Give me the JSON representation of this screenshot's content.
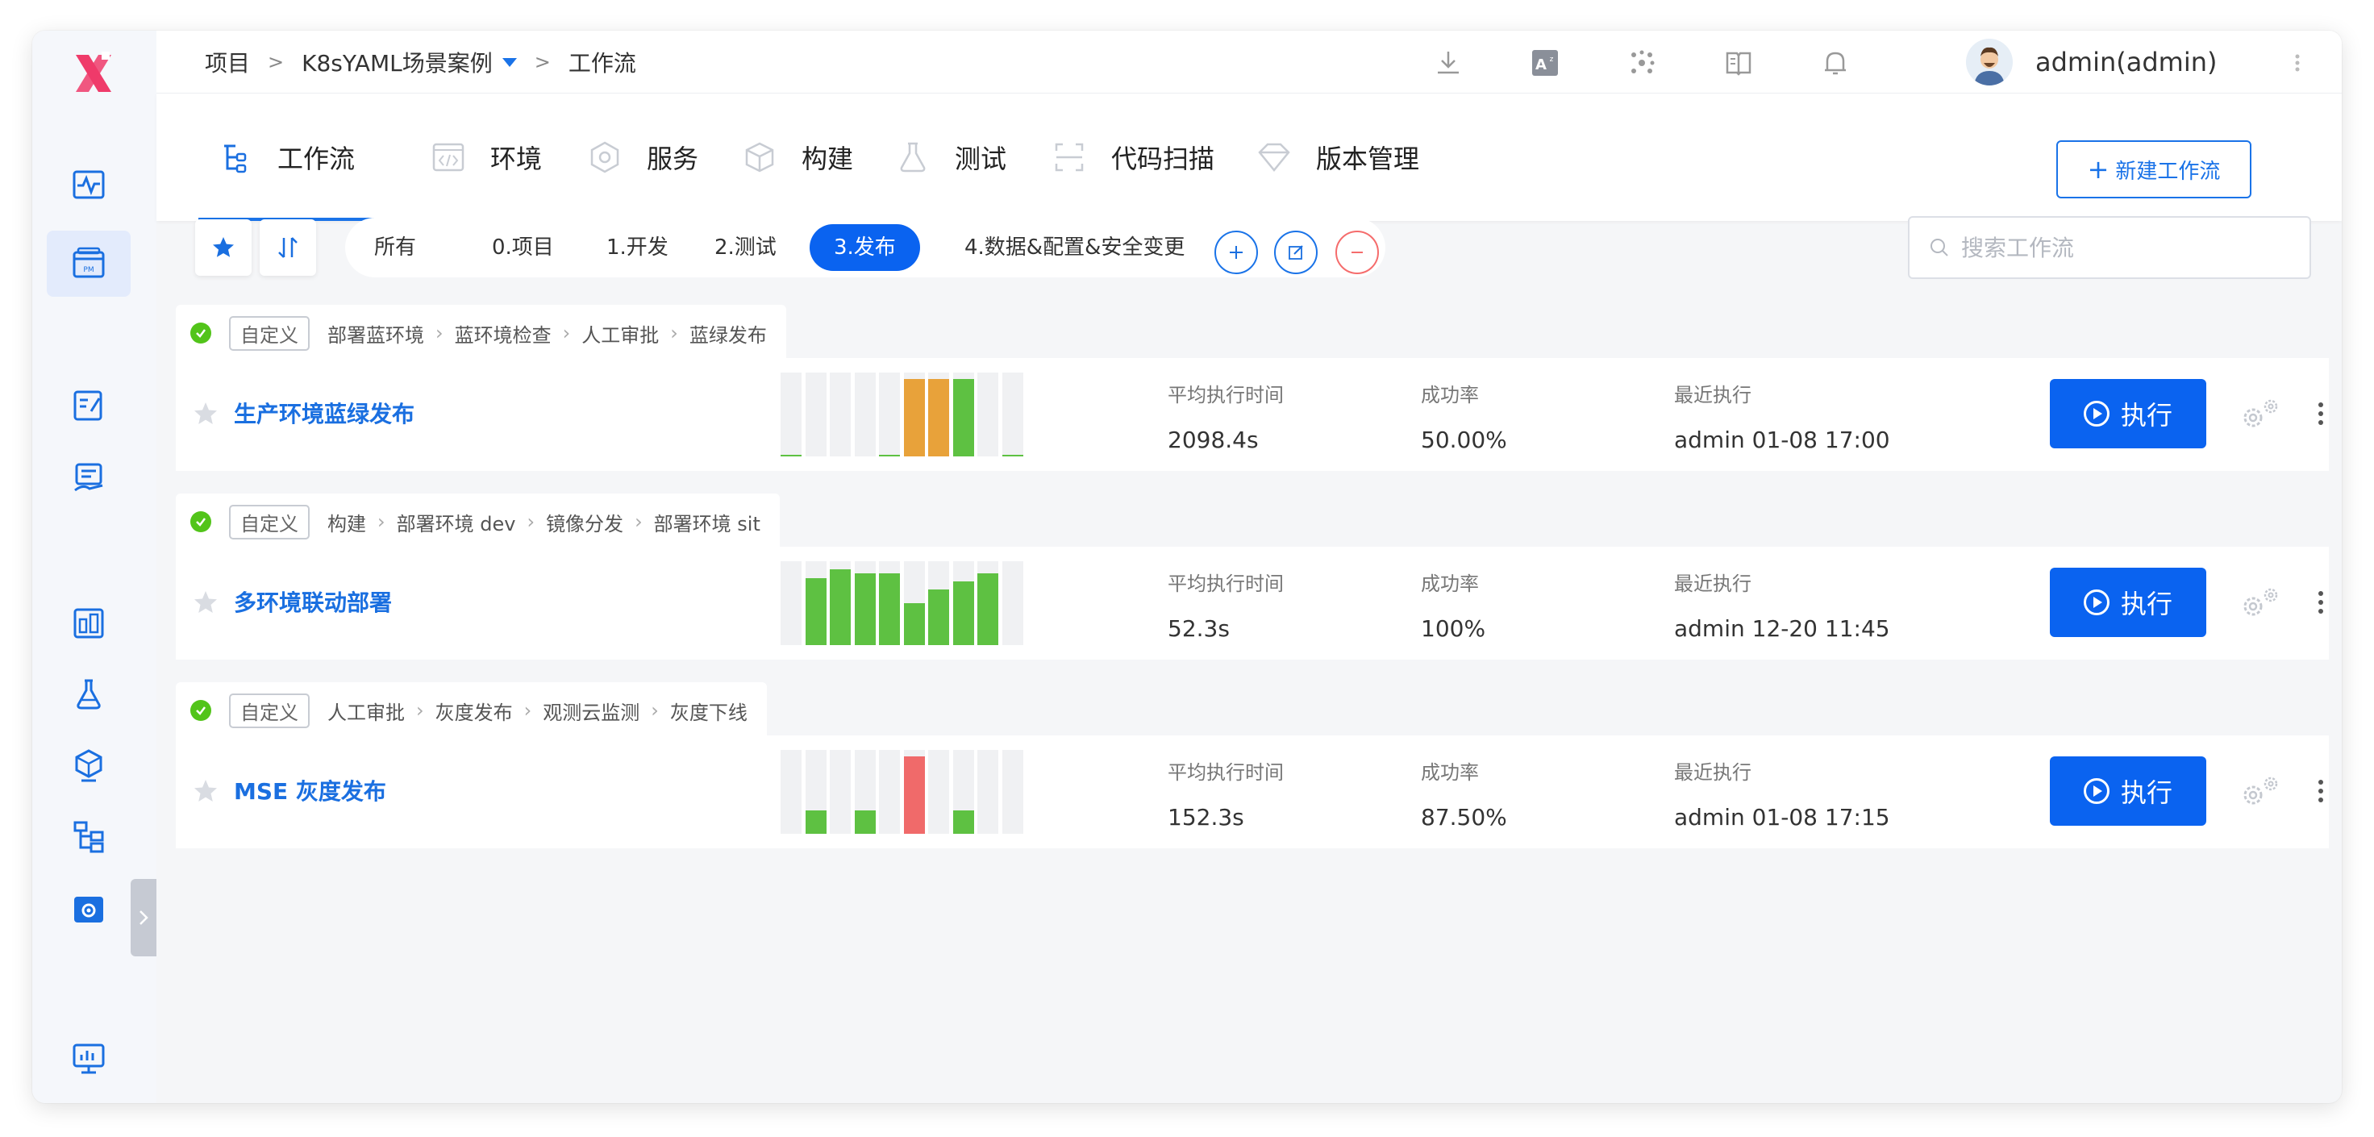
{
  "header": {
    "breadcrumb": [
      "项目",
      "K8sYAML场景案例",
      "工作流"
    ],
    "user": "admin(admin)"
  },
  "tabs": [
    {
      "label": "工作流",
      "icon": "workflow-icon",
      "active": true
    },
    {
      "label": "环境",
      "icon": "code-icon"
    },
    {
      "label": "服务",
      "icon": "service-icon"
    },
    {
      "label": "构建",
      "icon": "cube-icon"
    },
    {
      "label": "测试",
      "icon": "flask-icon"
    },
    {
      "label": "代码扫描",
      "icon": "scan-icon"
    },
    {
      "label": "版本管理",
      "icon": "diamond-icon"
    }
  ],
  "new_workflow_label": "新建工作流",
  "filters": {
    "groups": [
      "所有",
      "0.项目",
      "1.开发",
      "2.测试",
      "3.发布",
      "4.数据&配置&安全变更"
    ],
    "active": "3.发布"
  },
  "search": {
    "placeholder": "搜索工作流",
    "value": ""
  },
  "stat_labels": {
    "avg": "平均执行时间",
    "rate": "成功率",
    "last": "最近执行"
  },
  "run_label": "执行",
  "workflows": [
    {
      "badge": "自定义",
      "steps": [
        "部署蓝环境",
        "蓝环境检查",
        "人工审批",
        "蓝绿发布"
      ],
      "name": "生产环境蓝绿发布",
      "avg_time": "2098.4s",
      "success_rate": "50.00%",
      "last_run": "admin 01-08 17:00",
      "history": [
        {
          "level": 0.02,
          "status": "success"
        },
        {
          "level": 0,
          "status": "none"
        },
        {
          "level": 0,
          "status": "none"
        },
        {
          "level": 0,
          "status": "none"
        },
        {
          "level": 0.02,
          "status": "success"
        },
        {
          "level": 0.92,
          "status": "warning"
        },
        {
          "level": 0.92,
          "status": "warning"
        },
        {
          "level": 0.92,
          "status": "success"
        },
        {
          "level": 0,
          "status": "none"
        },
        {
          "level": 0.02,
          "status": "success"
        }
      ]
    },
    {
      "badge": "自定义",
      "steps": [
        "构建",
        "部署环境 dev",
        "镜像分发",
        "部署环境 sit"
      ],
      "name": "多环境联动部署",
      "avg_time": "52.3s",
      "success_rate": "100%",
      "last_run": "admin 12-20 11:45",
      "history": [
        {
          "level": 0,
          "status": "none"
        },
        {
          "level": 0.8,
          "status": "success"
        },
        {
          "level": 0.9,
          "status": "success"
        },
        {
          "level": 0.86,
          "status": "success"
        },
        {
          "level": 0.86,
          "status": "success"
        },
        {
          "level": 0.5,
          "status": "success"
        },
        {
          "level": 0.66,
          "status": "success"
        },
        {
          "level": 0.76,
          "status": "success"
        },
        {
          "level": 0.86,
          "status": "success"
        },
        {
          "level": 0,
          "status": "none"
        }
      ]
    },
    {
      "badge": "自定义",
      "steps": [
        "人工审批",
        "灰度发布",
        "观测云监测",
        "灰度下线"
      ],
      "name": "MSE 灰度发布",
      "avg_time": "152.3s",
      "success_rate": "87.50%",
      "last_run": "admin 01-08 17:15",
      "history": [
        {
          "level": 0,
          "status": "none"
        },
        {
          "level": 0.28,
          "status": "success"
        },
        {
          "level": 0,
          "status": "none"
        },
        {
          "level": 0.28,
          "status": "success"
        },
        {
          "level": 0,
          "status": "none"
        },
        {
          "level": 0.92,
          "status": "failed"
        },
        {
          "level": 0,
          "status": "none"
        },
        {
          "level": 0.28,
          "status": "success"
        },
        {
          "level": 0,
          "status": "none"
        },
        {
          "level": 0,
          "status": "none"
        }
      ]
    }
  ],
  "colors": {
    "primary": "#0a63f0",
    "success": "#5ec142",
    "warning": "#e8a23a",
    "failed": "#f06a6a",
    "logo": "#ef3b6a"
  }
}
